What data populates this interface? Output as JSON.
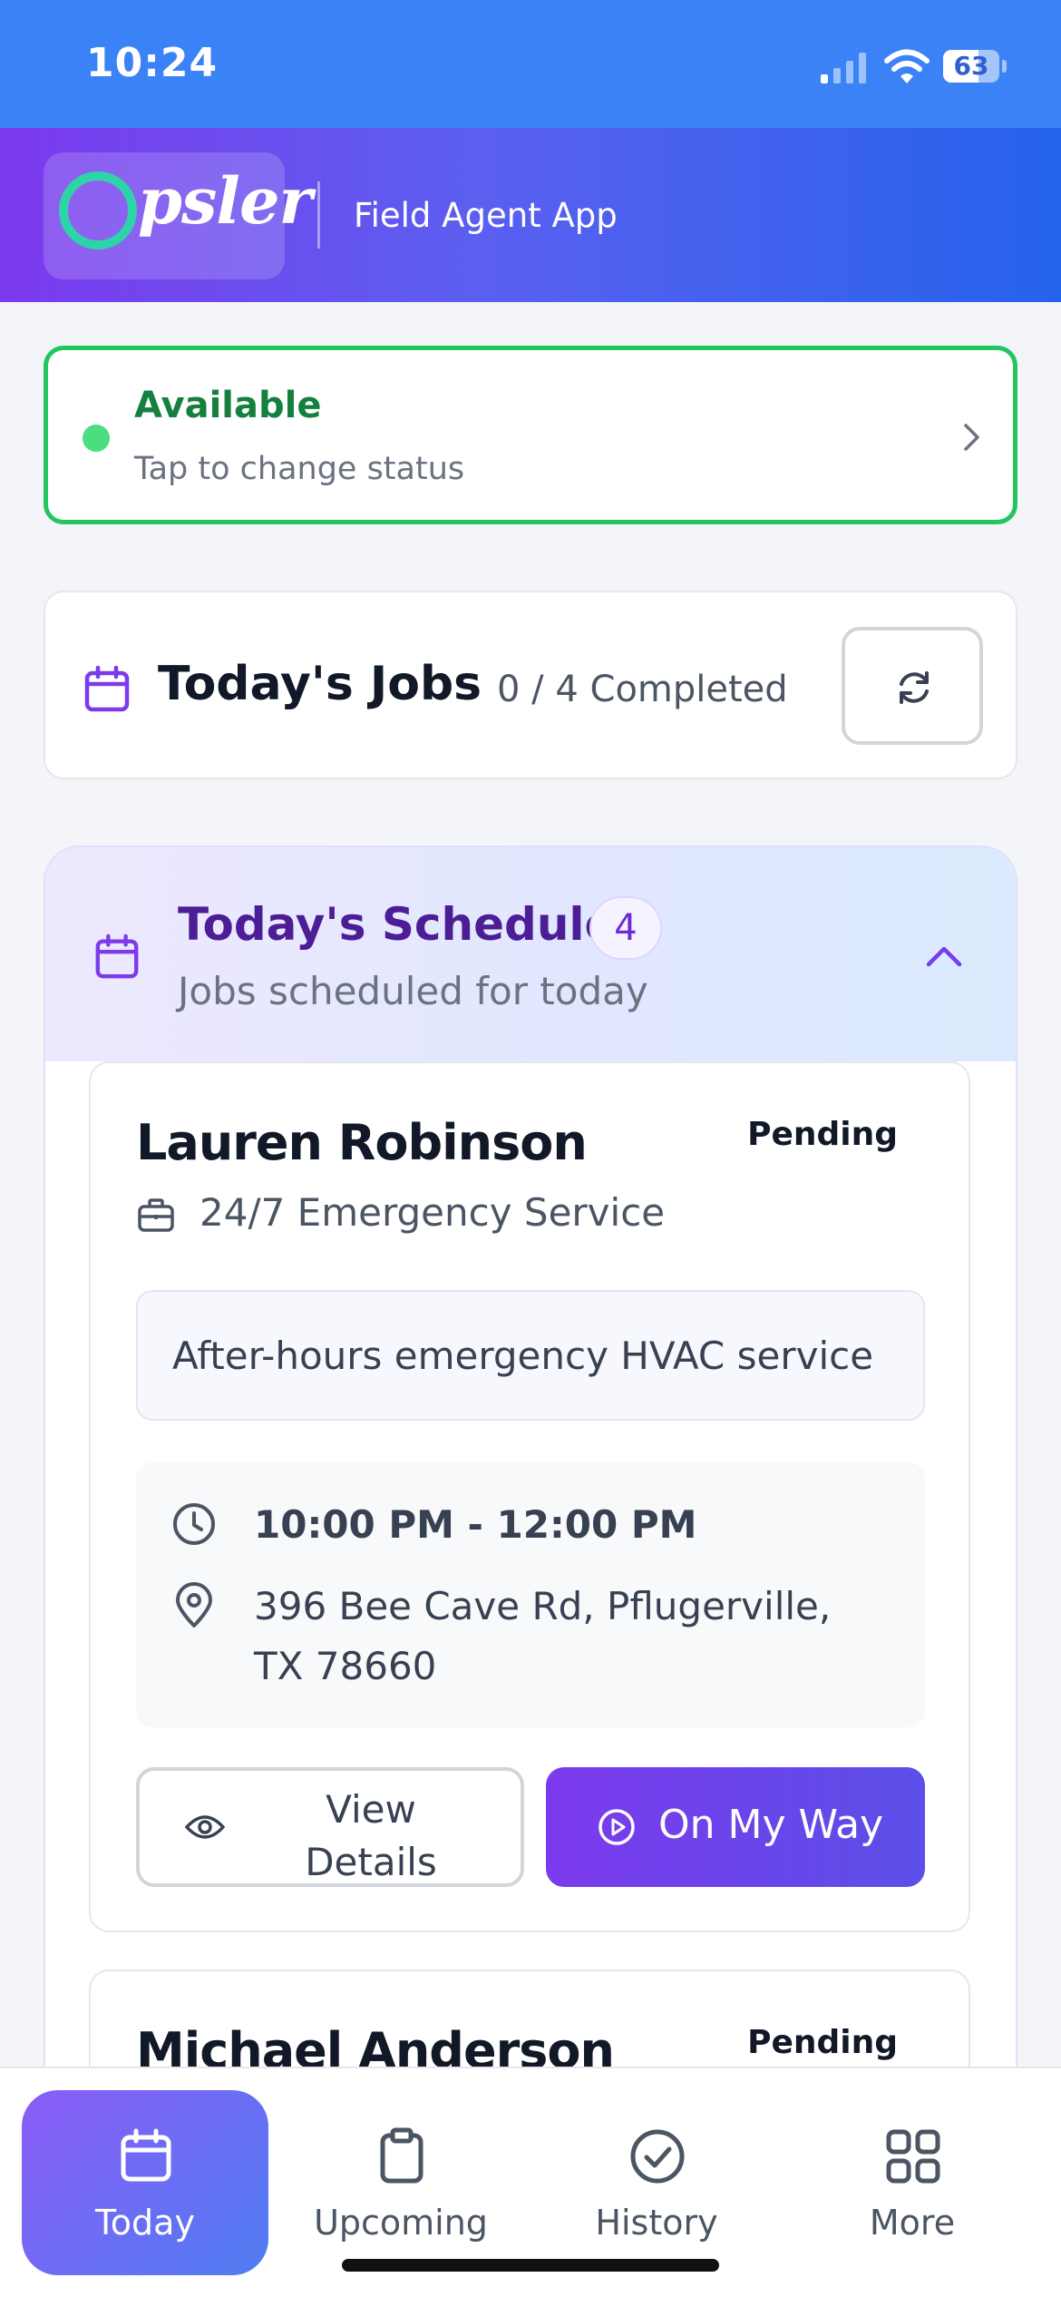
{
  "status_bar": {
    "time": "10:24",
    "battery": "63"
  },
  "header": {
    "logo_text": "psler",
    "subtitle": "Field Agent App"
  },
  "availability": {
    "title": "Available",
    "subtitle": "Tap to change status"
  },
  "jobs_summary": {
    "title": "Today's Jobs",
    "count": "0 / 4 Completed"
  },
  "schedule": {
    "title": "Today's Schedule",
    "badge": "4",
    "subtitle": "Jobs scheduled for today",
    "jobs": [
      {
        "name": "Lauren Robinson",
        "status": "Pending",
        "service": "24/7 Emergency Service",
        "description": "After-hours emergency HVAC service",
        "time": "10:00 PM - 12:00 PM",
        "address": "396 Bee Cave Rd, Pflugerville, TX 78660",
        "view_label": "View Details",
        "action_label": "On My Way"
      },
      {
        "name": "Michael Anderson",
        "status": "Pending"
      }
    ]
  },
  "nav": {
    "items": [
      {
        "label": "Today",
        "icon": "calendar-icon",
        "active": true
      },
      {
        "label": "Upcoming",
        "icon": "clipboard-icon",
        "active": false
      },
      {
        "label": "History",
        "icon": "check-circle-icon",
        "active": false
      },
      {
        "label": "More",
        "icon": "grid-icon",
        "active": false
      }
    ]
  },
  "colors": {
    "accent": "#7c3aed",
    "status_green": "#22c55e",
    "header_blue": "#2563eb"
  }
}
